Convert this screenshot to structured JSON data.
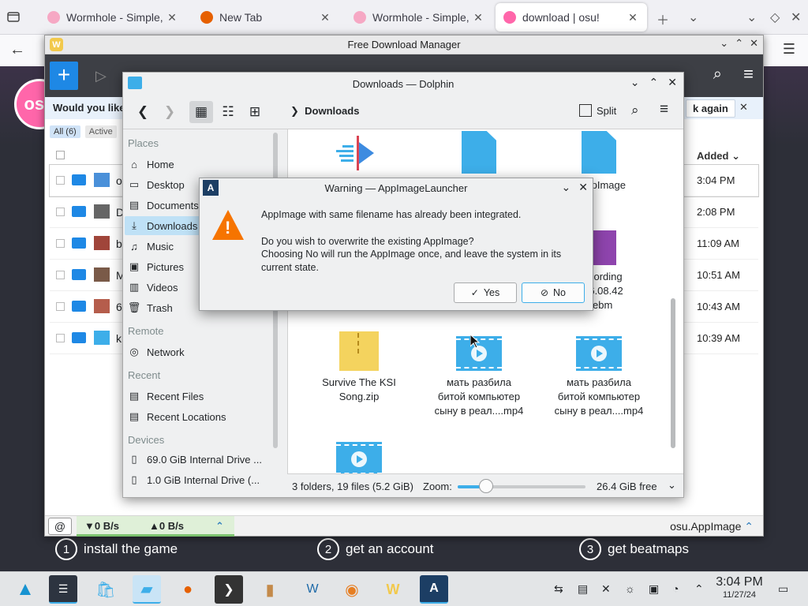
{
  "browser": {
    "tabs": [
      {
        "title": "Wormhole - Simple, p",
        "favicon_color": "#f6a8c4"
      },
      {
        "title": "New Tab",
        "favicon_color": "#e66000"
      },
      {
        "title": "Wormhole - Simple, p",
        "favicon_color": "#f6a8c4"
      },
      {
        "title": "download | osu!",
        "favicon_color": "#ff66aa"
      }
    ],
    "active_tab": 3
  },
  "osu_site": {
    "logo": "osu",
    "steps": [
      {
        "num": "1",
        "label": "install the game"
      },
      {
        "num": "2",
        "label": "get an account"
      },
      {
        "num": "3",
        "label": "get beatmaps"
      }
    ]
  },
  "fdm": {
    "title": "Free Download Manager",
    "banner_text": "Would you like",
    "banner_button": "k again",
    "filters": [
      "All (6)",
      "Active"
    ],
    "column_added": "Added",
    "rows": [
      {
        "name": "o",
        "time": "3:04 PM"
      },
      {
        "name": "D",
        "time": "2:08 PM"
      },
      {
        "name": "b",
        "time": "11:09 AM"
      },
      {
        "name": "M",
        "time": "10:51 AM"
      },
      {
        "name": "6",
        "time": "10:43 AM"
      },
      {
        "name": "k",
        "time": "10:39 AM"
      }
    ],
    "download_speed": "▼0 B/s",
    "upload_speed": "▲0 B/s",
    "current_file": "osu.AppImage"
  },
  "dolphin": {
    "title": "Downloads — Dolphin",
    "breadcrumb": "Downloads",
    "split_label": "Split",
    "places": {
      "heading_places": "Places",
      "places_items": [
        "Home",
        "Desktop",
        "Documents",
        "Downloads",
        "Music",
        "Pictures",
        "Videos",
        "Trash"
      ],
      "heading_remote": "Remote",
      "remote_items": [
        "Network"
      ],
      "heading_recent": "Recent",
      "recent_items": [
        "Recent Files",
        "Recent Locations"
      ],
      "heading_devices": "Devices",
      "device_items": [
        "69.0 GiB Internal Drive ...",
        "1.0 GiB Internal Drive (..."
      ]
    },
    "files": {
      "appimage_label": "pImage",
      "recording_label_1": "Recording",
      "recording_label_2": "27 6.08.42",
      "recording_label_3": "webm",
      "zip_label_1": "Survive The KSI",
      "zip_label_2": "Song.zip",
      "video1_label_1": "мать разбила",
      "video1_label_2": "битой компьютер",
      "video1_label_3": "сыну в реал....mp4",
      "video2_label_1": "мать разбила",
      "video2_label_2": "битой компьютер",
      "video2_label_3": "сыну в реал....mp4"
    },
    "status_info": "3 folders, 19 files (5.2 GiB)",
    "zoom_label": "Zoom:",
    "zoom_level": 0.22,
    "free_space": "26.4 GiB free"
  },
  "dialog": {
    "title": "Warning — AppImageLauncher",
    "line1": "AppImage with same filename has already been integrated.",
    "line2": "Do you wish to overwrite the existing AppImage?",
    "line3": "Choosing No will run the AppImage once, and leave the system in its current state.",
    "yes_label": "Yes",
    "no_label": "No"
  },
  "taskbar": {
    "time": "3:04 PM",
    "date": "11/27/24"
  }
}
